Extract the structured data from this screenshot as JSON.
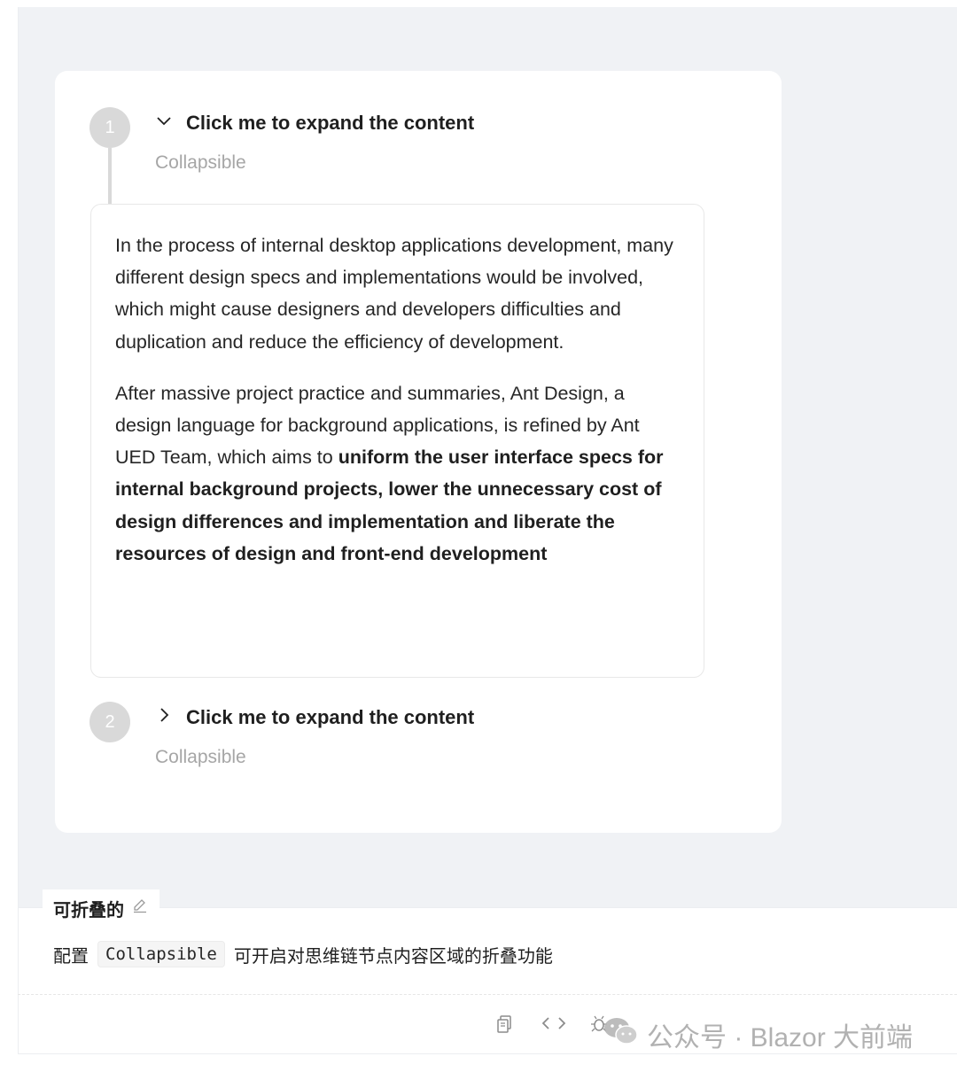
{
  "demo": {
    "nodes": [
      {
        "number": "1",
        "title": "Click me to expand the content",
        "description": "Collapsible",
        "expanded": true
      },
      {
        "number": "2",
        "title": "Click me to expand the content",
        "description": "Collapsible",
        "expanded": false
      }
    ],
    "content": {
      "paragraph1": "In the process of internal desktop applications development, many different design specs and implementations would be involved, which might cause designers and developers difficulties and duplication and reduce the efficiency of development.",
      "paragraph2_plain": "After massive project practice and summaries, Ant Design, a design language for background applications, is refined by Ant UED Team, which aims to ",
      "paragraph2_bold": "uniform the user interface specs for internal background projects, lower the unnecessary cost of design differences and implementation and liberate the resources of design and front-end development"
    }
  },
  "section": {
    "title": "可折叠的",
    "edit_icon": "edit-icon",
    "description_before": "配置",
    "code": "Collapsible",
    "description_after": "可开启对思维链节点内容区域的折叠功能"
  },
  "actions": {
    "icons": [
      "copy-icon",
      "code-icon",
      "bug-icon"
    ]
  },
  "watermark": {
    "text": "公众号 · Blazor 大前端",
    "icon": "wechat-icon"
  },
  "colors": {
    "demo_background": "#f0f2f5",
    "node_circle": "#d9d9d9",
    "description_text": "#a6a6a6"
  }
}
